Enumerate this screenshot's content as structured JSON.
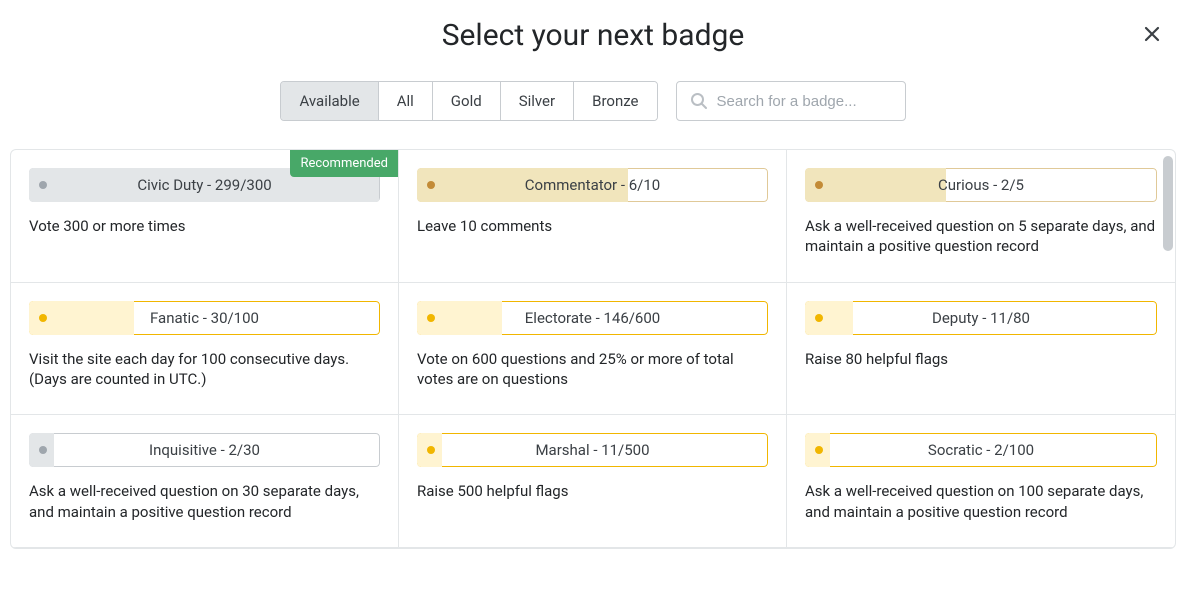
{
  "title": "Select your next badge",
  "tabs": [
    {
      "label": "Available",
      "active": true
    },
    {
      "label": "All",
      "active": false
    },
    {
      "label": "Gold",
      "active": false
    },
    {
      "label": "Silver",
      "active": false
    },
    {
      "label": "Bronze",
      "active": false
    }
  ],
  "search": {
    "placeholder": "Search for a badge..."
  },
  "recommended_label": "Recommended",
  "badges": [
    {
      "name": "Civic Duty",
      "current": 299,
      "target": 300,
      "tier": "silver",
      "recommended": true,
      "description": "Vote 300 or more times"
    },
    {
      "name": "Commentator",
      "current": 6,
      "target": 10,
      "tier": "bronze",
      "recommended": false,
      "description": "Leave 10 comments"
    },
    {
      "name": "Curious",
      "current": 2,
      "target": 5,
      "tier": "bronze",
      "recommended": false,
      "description": "Ask a well-received question on 5 separate days, and maintain a positive question record"
    },
    {
      "name": "Fanatic",
      "current": 30,
      "target": 100,
      "tier": "gold",
      "recommended": false,
      "description": "Visit the site each day for 100 consecutive days. (Days are counted in UTC.)"
    },
    {
      "name": "Electorate",
      "current": 146,
      "target": 600,
      "tier": "gold",
      "recommended": false,
      "description": "Vote on 600 questions and 25% or more of total votes are on questions"
    },
    {
      "name": "Deputy",
      "current": 11,
      "target": 80,
      "tier": "gold",
      "recommended": false,
      "description": "Raise 80 helpful flags"
    },
    {
      "name": "Inquisitive",
      "current": 2,
      "target": 30,
      "tier": "silver",
      "recommended": false,
      "description": "Ask a well-received question on 30 separate days, and maintain a positive question record"
    },
    {
      "name": "Marshal",
      "current": 11,
      "target": 500,
      "tier": "gold",
      "recommended": false,
      "description": "Raise 500 helpful flags"
    },
    {
      "name": "Socratic",
      "current": 2,
      "target": 100,
      "tier": "gold",
      "recommended": false,
      "description": "Ask a well-received question on 100 separate days, and maintain a positive question record"
    }
  ]
}
